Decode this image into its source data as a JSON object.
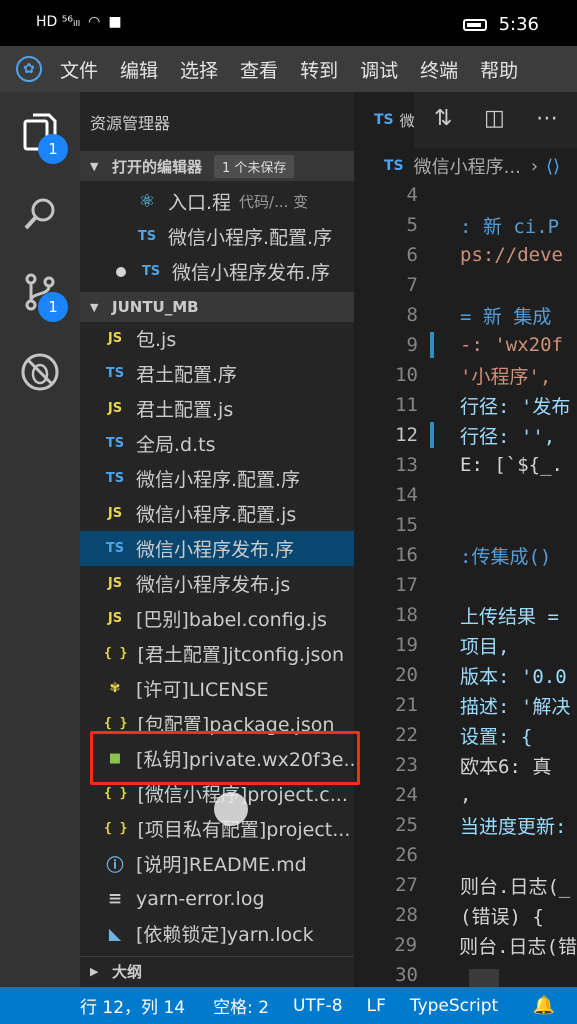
{
  "phone_status": {
    "left_icons": "HD ⁵⁶ᵢₗₗ",
    "time": "5:36"
  },
  "menu": {
    "items": [
      "文件",
      "编辑",
      "选择",
      "查看",
      "转到",
      "调试",
      "终端",
      "帮助"
    ]
  },
  "activity": {
    "explorer_badge": "1",
    "scm_badge": "1"
  },
  "sidebar": {
    "title": "资源管理器",
    "open_editors_header": "打开的编辑器",
    "unsaved_badge": "1 个未保存",
    "open_editors": [
      {
        "name": "入口.程",
        "hint": "代码/... 变"
      },
      {
        "name": "微信小程序.配置.序",
        "hint": ""
      },
      {
        "name": "微信小程序发布.序",
        "hint": ""
      }
    ],
    "project_header": "JUNTU_MB",
    "files": [
      {
        "icon": "JS",
        "name": "包.js"
      },
      {
        "icon": "TS",
        "name": "君土配置.序"
      },
      {
        "icon": "JS",
        "name": "君土配置.js"
      },
      {
        "icon": "TS",
        "name": "全局.d.ts"
      },
      {
        "icon": "TS",
        "name": "微信小程序.配置.序"
      },
      {
        "icon": "JS",
        "name": "微信小程序.配置.js"
      },
      {
        "icon": "TS",
        "name": "微信小程序发布.序"
      },
      {
        "icon": "JS",
        "name": "微信小程序发布.js"
      },
      {
        "icon": "JS",
        "name": "[巴别]babel.config.js"
      },
      {
        "icon": "{ }",
        "name": "[君土配置]jtconfig.json"
      },
      {
        "icon": "license",
        "name": "[许可]LICENSE"
      },
      {
        "icon": "{ }",
        "name": "[包配置]package.json"
      },
      {
        "icon": "lock",
        "name": "[私钥]private.wx20f3e..."
      },
      {
        "icon": "{ }",
        "name": "[微信小程序]project.c..."
      },
      {
        "icon": "{ }",
        "name": "[项目私有配置]project..."
      },
      {
        "icon": "info",
        "name": "[说明]README.md"
      },
      {
        "icon": "lines",
        "name": "yarn-error.log"
      },
      {
        "icon": "yarn",
        "name": "[依赖锁定]yarn.lock"
      }
    ],
    "outline_header": "大纲"
  },
  "tabs": {
    "active_icon": "TS",
    "active_label": "微"
  },
  "breadcrumb": {
    "icon": "TS",
    "label": "微信小程序...",
    "sep": "›"
  },
  "editor": {
    "lines": [
      {
        "n": "4",
        "code": ""
      },
      {
        "n": "5",
        "code": ":  新 ci.P"
      },
      {
        "n": "6",
        "code": "ps://deve"
      },
      {
        "n": "7",
        "code": ""
      },
      {
        "n": "8",
        "code": " = 新 集成"
      },
      {
        "n": "9",
        "code": "-: 'wx20f"
      },
      {
        "n": "10",
        "code": " '小程序',"
      },
      {
        "n": "11",
        "code": "行径: '发布"
      },
      {
        "n": "12",
        "code": "行径: '',"
      },
      {
        "n": "13",
        "code": "E: [`${_."
      },
      {
        "n": "14",
        "code": ""
      },
      {
        "n": "15",
        "code": ""
      },
      {
        "n": "16",
        "code": ":传集成()"
      },
      {
        "n": "17",
        "code": ""
      },
      {
        "n": "18",
        "code": "上传结果 ="
      },
      {
        "n": "19",
        "code": "项目,"
      },
      {
        "n": "20",
        "code": "版本: '0.0"
      },
      {
        "n": "21",
        "code": "描述: '解决"
      },
      {
        "n": "22",
        "code": "设置: {"
      },
      {
        "n": "23",
        "code": "  欧本6: 真"
      },
      {
        "n": "24",
        "code": ","
      },
      {
        "n": "25",
        "code": "当进度更新:"
      },
      {
        "n": "26",
        "code": ""
      },
      {
        "n": "27",
        "code": "则台.日志(_"
      },
      {
        "n": "28",
        "code": "(错误) {"
      },
      {
        "n": "29",
        "code": "则台.日志(错"
      },
      {
        "n": "30",
        "code": ""
      }
    ]
  },
  "status": {
    "position": "行 12，列 14",
    "spaces": "空格: 2",
    "encoding": "UTF-8",
    "eol": "LF",
    "language": "TypeScript"
  }
}
